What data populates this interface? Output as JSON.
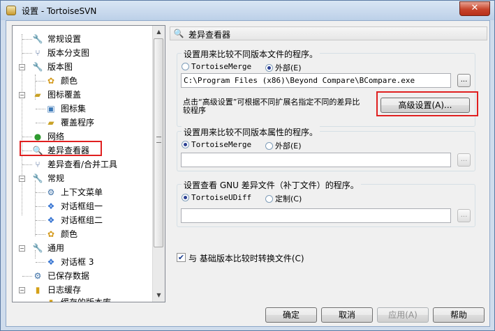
{
  "window": {
    "title": "设置 - TortoiseSVN",
    "close_label": "✕"
  },
  "tree": {
    "items": [
      {
        "label": "常规设置",
        "icon": "wrench-icon"
      },
      {
        "label": "版本分支图",
        "icon": "branch-graph-icon"
      },
      {
        "label": "版本图",
        "icon": "wrench-icon"
      },
      {
        "label": "颜色",
        "icon": "palette-icon"
      },
      {
        "label": "图标覆盖",
        "icon": "folder-overlay-icon"
      },
      {
        "label": "图标集",
        "icon": "icon-set-icon"
      },
      {
        "label": "覆盖程序",
        "icon": "folder-overlay-icon"
      },
      {
        "label": "网络",
        "icon": "globe-icon"
      },
      {
        "label": "差异查看器",
        "icon": "magnifier-icon"
      },
      {
        "label": "差异查看/合并工具",
        "icon": "merge-tool-icon"
      },
      {
        "label": "常规",
        "icon": "wrench-icon"
      },
      {
        "label": "上下文菜单",
        "icon": "gear-icon"
      },
      {
        "label": "对话框组一",
        "icon": "windows-flag-icon"
      },
      {
        "label": "对话框组二",
        "icon": "windows-flag-icon"
      },
      {
        "label": "颜色",
        "icon": "palette-icon"
      },
      {
        "label": "通用",
        "icon": "wrench-icon"
      },
      {
        "label": "对话框 3",
        "icon": "windows-flag-icon"
      },
      {
        "label": "已保存数据",
        "icon": "gear-icon"
      },
      {
        "label": "日志缓存",
        "icon": "database-icon"
      },
      {
        "label": "缓存的版本库",
        "icon": "database-icon"
      }
    ]
  },
  "panel": {
    "title": "差异查看器",
    "group1": {
      "label": "设置用来比较不同版本文件的程序。",
      "option_internal": "TortoiseMerge",
      "option_external": "外部(E)",
      "path_value": "C:\\Program Files (x86)\\Beyond Compare\\BCompare.exe",
      "browse_label": "...",
      "hint": "点击“高级设置”可根据不同扩展名指定不同的差异比较程序",
      "advanced_button": "高级设置(A)..."
    },
    "group2": {
      "label": "设置用来比较不同版本属性的程序。",
      "option_internal": "TortoiseMerge",
      "option_external": "外部(E)",
      "path_value": "",
      "browse_label": "..."
    },
    "group3": {
      "label": "设置查看 GNU 差异文件（补丁文件）的程序。",
      "option_internal": "TortoiseUDiff",
      "option_custom": "定制(C)",
      "path_value": "",
      "browse_label": "..."
    },
    "convert_checkbox": {
      "label": "与 基础版本比较时转换文件(C)",
      "checked": true
    }
  },
  "footer": {
    "ok": "确定",
    "cancel": "取消",
    "apply": "应用(A)",
    "help": "帮助"
  }
}
